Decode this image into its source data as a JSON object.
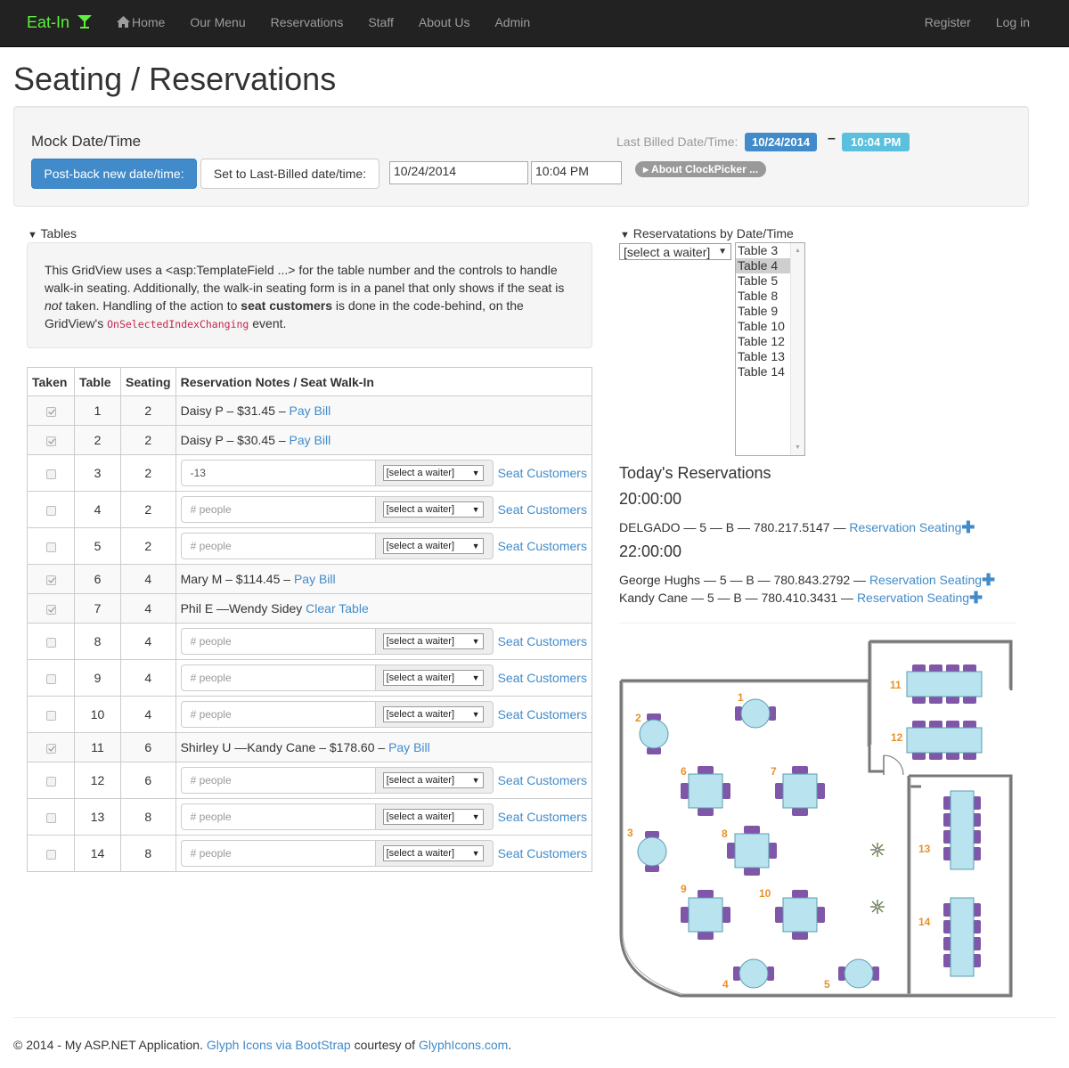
{
  "nav": {
    "brand": "Eat-In",
    "items": [
      "Home",
      "Our Menu",
      "Reservations",
      "Staff",
      "About Us",
      "Admin"
    ],
    "right": [
      "Register",
      "Log in"
    ]
  },
  "page_title": "Seating / Reservations",
  "mock": {
    "title": "Mock Date/Time",
    "postback_label": "Post-back new date/time:",
    "set_last_label": "Set to Last-Billed date/time:",
    "date_value": "10/24/2014",
    "time_value": "10:04  PM",
    "last_billed_label": "Last Billed Date/Time:",
    "last_billed_date": "10/24/2014",
    "dash": "–",
    "last_billed_time": "10:04 PM",
    "clockpicker_label": "About ClockPicker ..."
  },
  "tables_section": {
    "summary": "Tables",
    "info_p1": "This GridView uses a <asp:TemplateField ...> for the table number and the controls to handle walk-in seating. Additionally, the walk-in seating form is in a panel that only shows if the seat is ",
    "info_em": "not",
    "info_p2": " taken. Handling of the action to ",
    "info_strong": "seat customers",
    "info_p3": " is done in the code-behind, on the GridView's ",
    "info_code": "OnSelectedIndexChanging",
    "info_p4": " event."
  },
  "grid": {
    "headers": [
      "Taken",
      "Table",
      "Seating",
      "Reservation Notes / Seat Walk-In"
    ],
    "people_placeholder": "# people",
    "waiter_placeholder": "[select a waiter]",
    "seat_label": "Seat Customers",
    "rows": [
      {
        "taken": true,
        "table": "1",
        "seating": "2",
        "note": "Daisy P – $31.45 – ",
        "link": "Pay Bill"
      },
      {
        "taken": true,
        "table": "2",
        "seating": "2",
        "note": "Daisy P – $30.45 – ",
        "link": "Pay Bill"
      },
      {
        "taken": false,
        "table": "3",
        "seating": "2",
        "people_value": "-13"
      },
      {
        "taken": false,
        "table": "4",
        "seating": "2"
      },
      {
        "taken": false,
        "table": "5",
        "seating": "2"
      },
      {
        "taken": true,
        "table": "6",
        "seating": "4",
        "note": "Mary M – $114.45 – ",
        "link": "Pay Bill"
      },
      {
        "taken": true,
        "table": "7",
        "seating": "4",
        "note": "Phil E —Wendy Sidey ",
        "link": "Clear Table"
      },
      {
        "taken": false,
        "table": "8",
        "seating": "4"
      },
      {
        "taken": false,
        "table": "9",
        "seating": "4"
      },
      {
        "taken": false,
        "table": "10",
        "seating": "4"
      },
      {
        "taken": true,
        "table": "11",
        "seating": "6",
        "note": "Shirley U —Kandy Cane – $178.60 – ",
        "link": "Pay Bill"
      },
      {
        "taken": false,
        "table": "12",
        "seating": "6"
      },
      {
        "taken": false,
        "table": "13",
        "seating": "8"
      },
      {
        "taken": false,
        "table": "14",
        "seating": "8"
      }
    ]
  },
  "reservations": {
    "summary": "Reservatations by Date/Time",
    "waiter_dropdown": "[select a waiter]",
    "listbox": [
      "Table 3",
      "Table 4",
      "Table 5",
      "Table 8",
      "Table 9",
      "Table 10",
      "Table 12",
      "Table 13",
      "Table 14"
    ],
    "listbox_selected": "Table 4",
    "todays_title": "Today's Reservations",
    "link_label": "Reservation Seating",
    "slots": [
      {
        "time": "20:00:00",
        "entries": [
          "DELGADO — 5 — B — 780.217.5147 — "
        ]
      },
      {
        "time": "22:00:00",
        "entries": [
          "George Hughs — 5 — B — 780.843.2792 — ",
          "Kandy Cane — 5 — B — 780.410.3431 — "
        ]
      }
    ]
  },
  "floorplan": {
    "table_numbers": [
      "1",
      "2",
      "3",
      "4",
      "5",
      "6",
      "7",
      "8",
      "9",
      "10",
      "11",
      "12",
      "13",
      "14"
    ],
    "number_color": "#e8912b",
    "table_color": "#b9e3ef",
    "chair_color": "#7f56a8"
  },
  "footer": {
    "text1": "© 2014 - My ASP.NET Application. ",
    "link1": "Glyph Icons via BootStrap",
    "text2": " courtesy of ",
    "link2": "GlyphIcons.com",
    "text3": "."
  },
  "colors": {
    "primary": "#428bca",
    "info": "#5bc0de",
    "brand": "#5cf13a",
    "navbar": "#222222"
  }
}
